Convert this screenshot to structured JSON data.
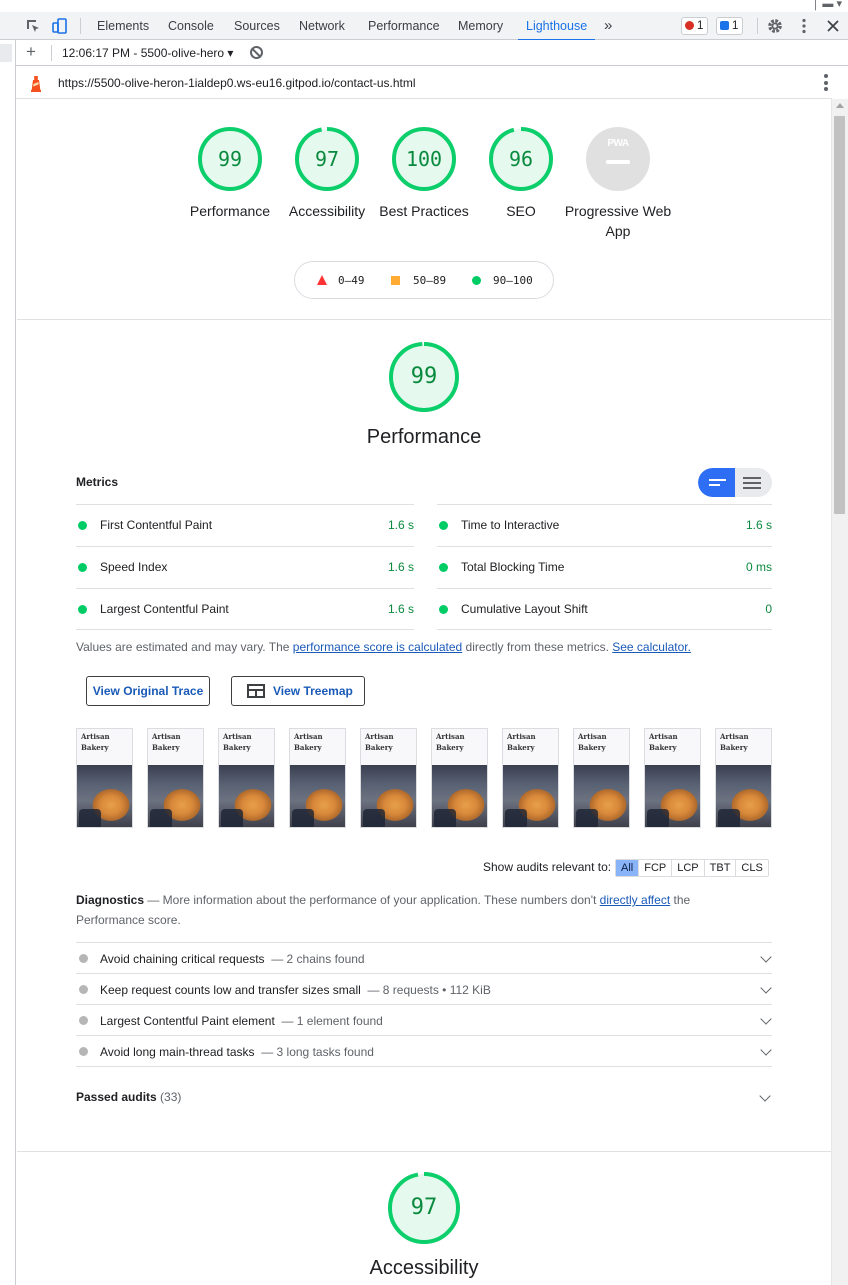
{
  "devtools": {
    "tabs": [
      "Elements",
      "Console",
      "Sources",
      "Network",
      "Performance",
      "Memory",
      "Lighthouse"
    ],
    "active_tab": "Lighthouse",
    "more_tabs": "»",
    "error_count": "1",
    "message_count": "1"
  },
  "report_bar": {
    "add": "+",
    "selected_report": "12:06:17 PM - 5500-olive-hero ▾"
  },
  "url_bar": {
    "url": "https://5500-olive-heron-1ialdep0.ws-eu16.gitpod.io/contact-us.html"
  },
  "scores": [
    {
      "label": "Performance",
      "value": "99"
    },
    {
      "label": "Accessibility",
      "value": "97"
    },
    {
      "label": "Best Practices",
      "value": "100"
    },
    {
      "label": "SEO",
      "value": "96"
    },
    {
      "label": "Progressive Web App",
      "value": "PWA"
    }
  ],
  "legend": {
    "fail": "0–49",
    "average": "50–89",
    "pass": "90–100"
  },
  "performance": {
    "score": "99",
    "title": "Performance",
    "metrics_heading": "Metrics",
    "metrics": [
      {
        "title": "First Contentful Paint",
        "value": "1.6 s"
      },
      {
        "title": "Time to Interactive",
        "value": "1.6 s"
      },
      {
        "title": "Speed Index",
        "value": "1.6 s"
      },
      {
        "title": "Total Blocking Time",
        "value": "0 ms"
      },
      {
        "title": "Largest Contentful Paint",
        "value": "1.6 s"
      },
      {
        "title": "Cumulative Layout Shift",
        "value": "0"
      }
    ],
    "note": {
      "pre": "Values are estimated and may vary. The ",
      "link1": "performance score is calculated",
      "mid": " directly from these metrics. ",
      "link2": "See calculator."
    },
    "buttons": {
      "trace": "View Original Trace",
      "treemap": "View Treemap"
    },
    "filmstrip": {
      "title_line1": "Artisan",
      "title_line2": "Bakery"
    },
    "filter_label": "Show audits relevant to:",
    "filters": [
      "All",
      "FCP",
      "LCP",
      "TBT",
      "CLS"
    ],
    "diagnostics": {
      "heading": "Diagnostics",
      "desc_pre": " — More information about the performance of your application. These numbers don't ",
      "link": "directly affect",
      "desc_post": " the Performance score."
    },
    "audits": [
      {
        "title": "Avoid chaining critical requests",
        "desc": "— 2 chains found"
      },
      {
        "title": "Keep request counts low and transfer sizes small",
        "desc": "— 8 requests • 112 KiB"
      },
      {
        "title": "Largest Contentful Paint element",
        "desc": "— 1 element found"
      },
      {
        "title": "Avoid long main-thread tasks",
        "desc": "— 3 long tasks found"
      }
    ],
    "passed_label": "Passed audits",
    "passed_count": "(33)"
  },
  "accessibility": {
    "score": "97",
    "title": "Accessibility"
  },
  "colors": {
    "pass": "#0cce6b",
    "pass_text": "#0a8a3e",
    "pass_fill": "#e6f9ee",
    "fail": "#ff3333",
    "average": "#ffaa33",
    "link": "#1a5ab8",
    "accent": "#1a73e8"
  }
}
